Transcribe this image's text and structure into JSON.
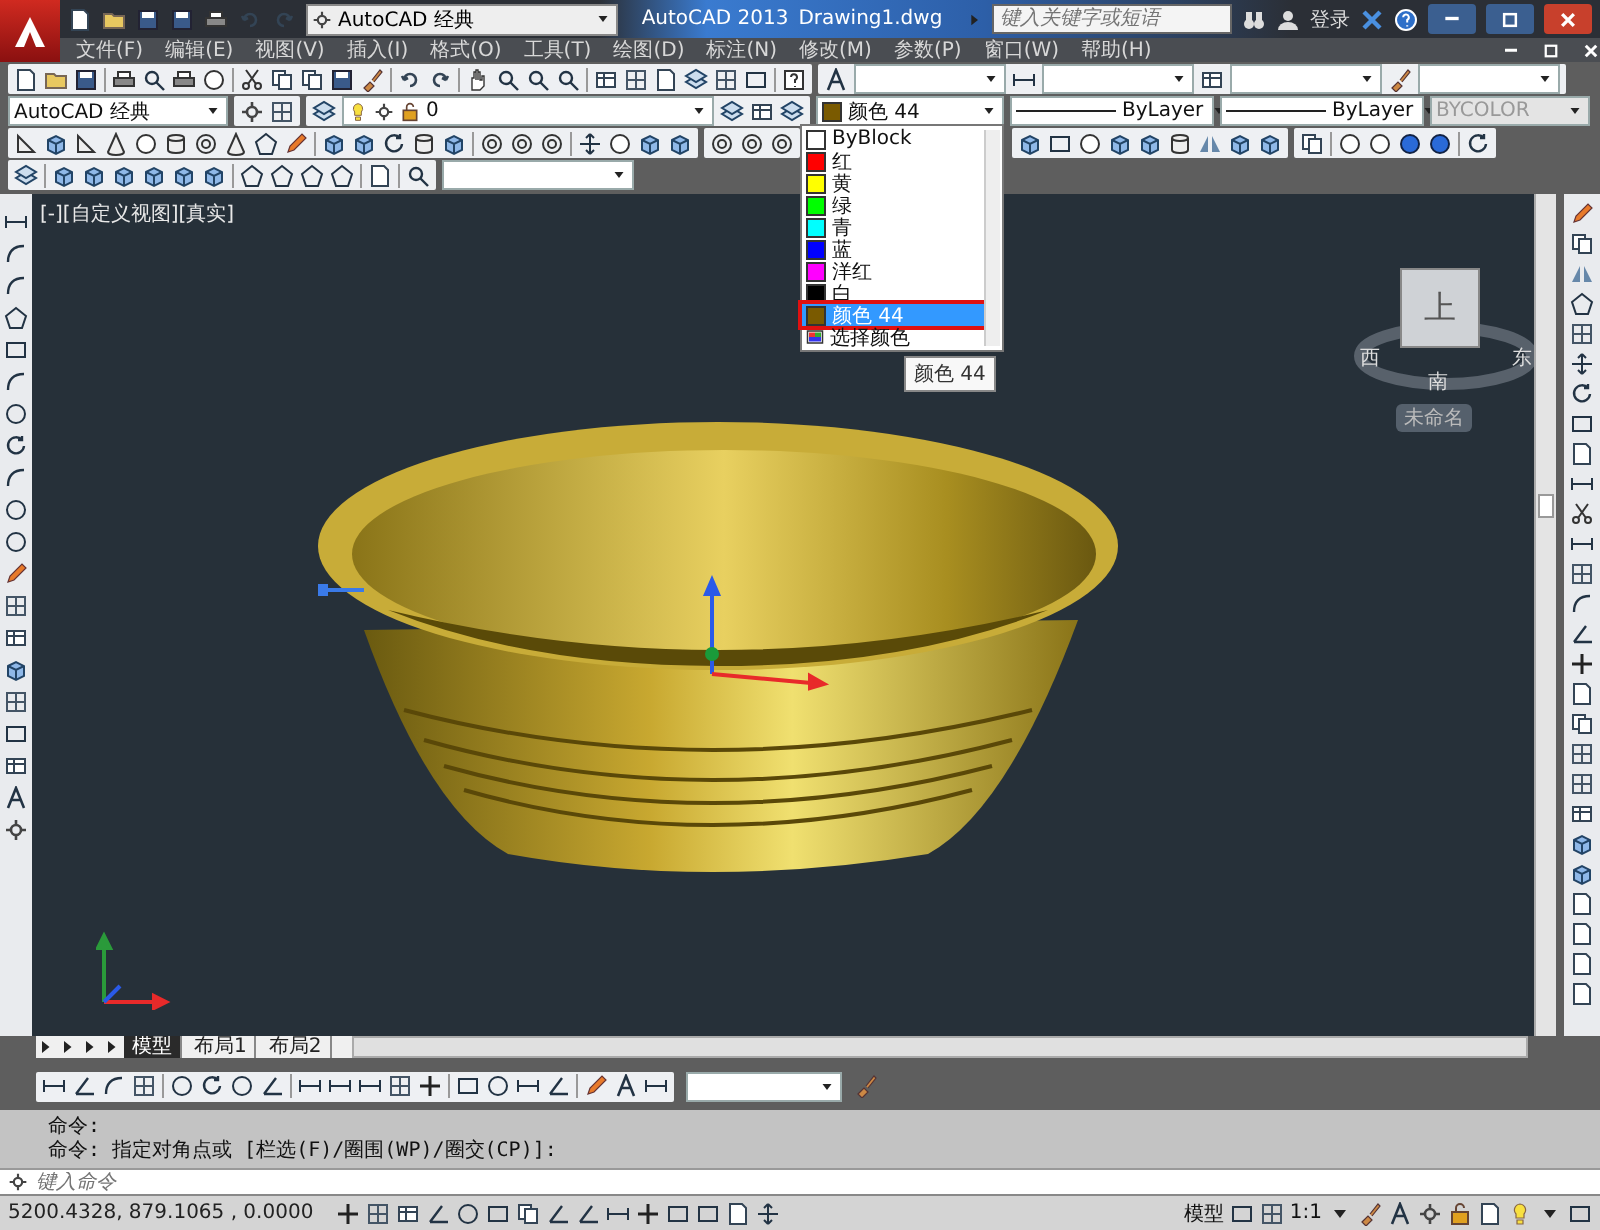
{
  "title_bar": {
    "workspace": "AutoCAD 经典",
    "app_title": "AutoCAD 2013",
    "file_name": "Drawing1.dwg",
    "search": {
      "placeholder": "键入关键字或短语"
    },
    "sign_in": "登录"
  },
  "menu_bar": {
    "items": [
      "文件(F)",
      "编辑(E)",
      "视图(V)",
      "插入(I)",
      "格式(O)",
      "工具(T)",
      "绘图(D)",
      "标注(N)",
      "修改(M)",
      "参数(P)",
      "窗口(W)",
      "帮助(H)"
    ]
  },
  "properties_toolbar": {
    "workspace": "AutoCAD 经典",
    "layer": "0",
    "color": {
      "label": "颜色 44",
      "color": "#7a5a00"
    },
    "linetype": "ByLayer",
    "lineweight": "ByLayer",
    "plot_style": {
      "label": "BYCOLOR",
      "disabled": true
    }
  },
  "color_dropdown": {
    "items": [
      {
        "kind": "swatch",
        "label": "ByBlock",
        "color": "#ffffff",
        "selected": false,
        "annotated": false
      },
      {
        "kind": "swatch",
        "label": "红",
        "color": "#ff0000",
        "selected": false,
        "annotated": false
      },
      {
        "kind": "swatch",
        "label": "黄",
        "color": "#ffff00",
        "selected": false,
        "annotated": false
      },
      {
        "kind": "swatch",
        "label": "绿",
        "color": "#00ff00",
        "selected": false,
        "annotated": false
      },
      {
        "kind": "swatch",
        "label": "青",
        "color": "#00ffff",
        "selected": false,
        "annotated": false
      },
      {
        "kind": "swatch",
        "label": "蓝",
        "color": "#0000ff",
        "selected": false,
        "annotated": false
      },
      {
        "kind": "swatch",
        "label": "洋红",
        "color": "#ff00ff",
        "selected": false,
        "annotated": false
      },
      {
        "kind": "swatch",
        "label": "白",
        "color": "#000000",
        "selected": false,
        "annotated": false
      },
      {
        "kind": "swatch",
        "label": "颜色 44",
        "color": "#7a5a00",
        "selected": true,
        "annotated": true
      },
      {
        "kind": "command",
        "label": "选择颜色",
        "selected": false,
        "annotated": false
      }
    ],
    "tooltip": "颜色 44"
  },
  "viewport": {
    "label": "[-][自定义视图][真实]"
  },
  "view_cube": {
    "face": "上",
    "west": "西",
    "east": "东",
    "south": "南",
    "view_name": "未命名"
  },
  "layout_tabs": [
    {
      "label": "模型",
      "selected": true
    },
    {
      "label": "布局1",
      "selected": false
    },
    {
      "label": "布局2",
      "selected": false
    }
  ],
  "command_line": {
    "history": [
      "命令:",
      "命令: 指定对角点或 [栏选(F)/圈围(WP)/圈交(CP)]:"
    ],
    "placeholder": "键入命令"
  },
  "status_bar": {
    "coordinates": "5200.4328, 879.1065 , 0.0000",
    "model": "模型",
    "scale": "1:1"
  }
}
